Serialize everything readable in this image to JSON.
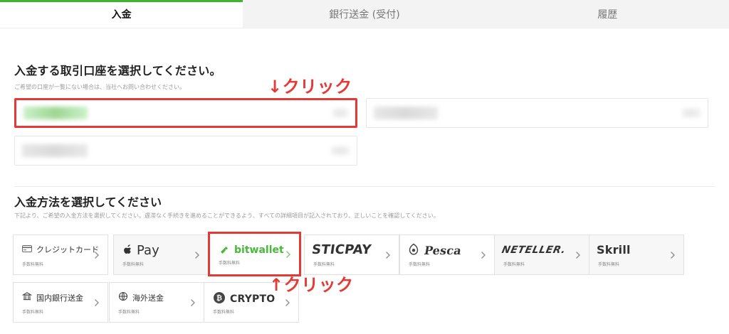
{
  "tabs": [
    {
      "label": "入金"
    },
    {
      "label": "銀行送金 (受付)"
    },
    {
      "label": "履歴"
    }
  ],
  "section1": {
    "title": "入金する取引口座を選択してください。",
    "subtitle": "ご希望の口座が一覧にない場合は、当社へお問い合わせください。"
  },
  "annotations": {
    "top_click": "↓クリック",
    "bottom_click": "↑クリック"
  },
  "section2": {
    "title": "入金方法を選択してください",
    "subtitle": "下記より、ご希望の入金方法を選択してください。遅滞なく手続きを進めることができるよう、すべての詳細項目が記入されており、正しいことを確認してください。"
  },
  "methods": [
    {
      "name": "クレジットカード",
      "fee": "手数料無料",
      "icon": "credit-card-icon"
    },
    {
      "name": "Apple Pay",
      "display": "Pay",
      "fee": "手数料無料",
      "icon": "apple-icon"
    },
    {
      "name": "bitwallet",
      "fee": "手数料無料",
      "icon": "bitwallet-icon"
    },
    {
      "name": "STICPAY",
      "fee": "手数料無料",
      "icon": "sticpay-logo"
    },
    {
      "name": "Pesca",
      "display": "Pesca",
      "fee": "手数料無料",
      "icon": "pesca-logo"
    },
    {
      "name": "NETELLER",
      "display": "NETELLER.",
      "fee": "手数料無料",
      "icon": "neteller-logo"
    },
    {
      "name": "Skrill",
      "fee": "手数料無料",
      "icon": "skrill-logo"
    },
    {
      "name": "国内銀行送金",
      "fee": "手数料無料",
      "icon": "bank-icon"
    },
    {
      "name": "海外送金",
      "fee": "手数料無料",
      "icon": "globe-icon"
    },
    {
      "name": "CRYPTO",
      "fee": "手数料無料",
      "icon": "bitcoin-icon"
    }
  ],
  "colors": {
    "accent_green": "#41b42f",
    "annotation_red": "#e53935",
    "bitwallet_green": "#48b93a"
  }
}
